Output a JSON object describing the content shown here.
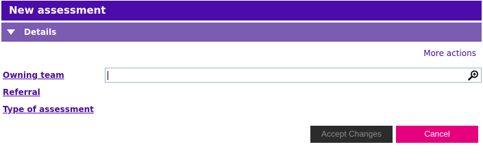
{
  "header": {
    "title": "New assessment"
  },
  "section": {
    "label": "Details",
    "expanded": true
  },
  "more_actions_label": "More actions",
  "fields": {
    "owning_team": {
      "label": "Owning team",
      "value": ""
    },
    "referral": {
      "label": "Referral"
    },
    "type_of_assessment": {
      "label": "Type of assessment"
    }
  },
  "buttons": {
    "accept_label": "Accept Changes",
    "cancel_label": "Cancel"
  },
  "colors": {
    "title_bar": "#4b0caa",
    "section_bar": "#7c5bb2",
    "link": "#4a0a9e",
    "accept_bg": "#2b2b2b",
    "cancel_bg": "#e5007e"
  },
  "icons": {
    "section_toggle": "triangle-down-icon",
    "lookup": "magnifier-plus-icon"
  }
}
